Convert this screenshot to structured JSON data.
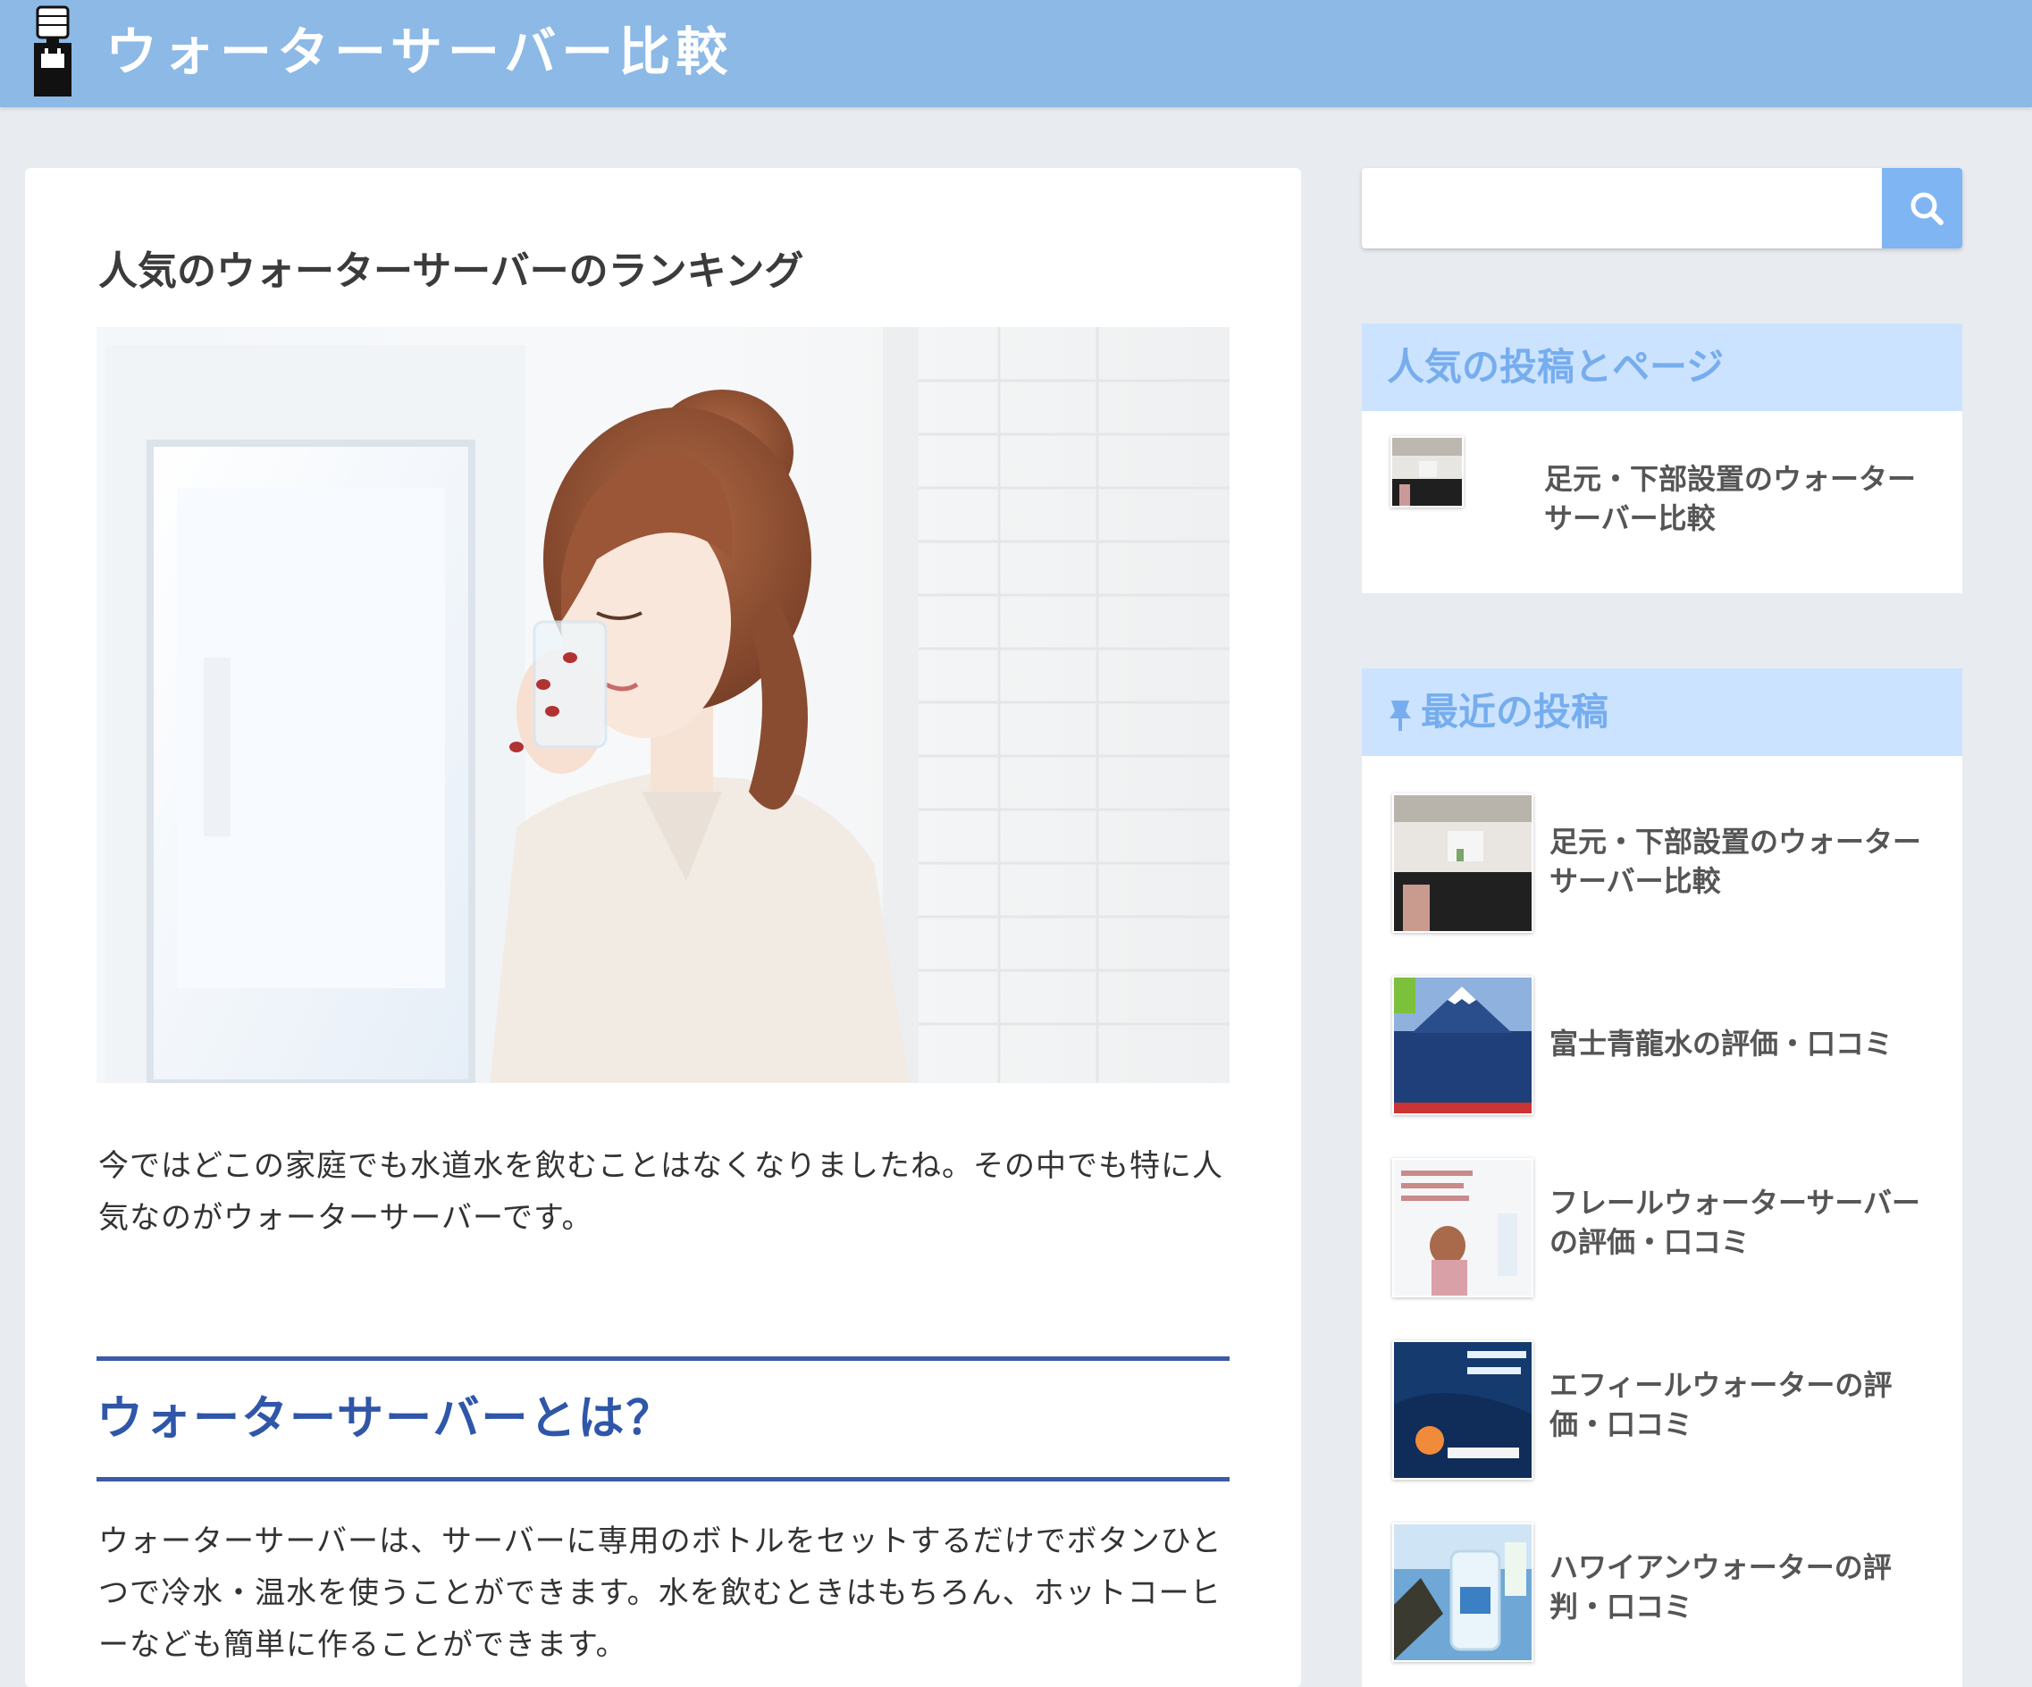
{
  "header": {
    "site_title": "ウォーターサーバー比較"
  },
  "article": {
    "title": "人気のウォーターサーバーのランキング",
    "intro": "今ではどこの家庭でも水道水を飲むことはなくなりましたね。その中でも特に人気なのがウォーターサーバーです。",
    "h2": "ウォーターサーバーとは？",
    "para2": "ウォーターサーバーは、サーバーに専用のボトルをセットするだけでボタンひとつで冷水・温水を使うことができます。水を飲むときはもちろん、ホットコーヒーなども簡単に作ることができます。"
  },
  "sidebar": {
    "search": {
      "placeholder": ""
    },
    "popular": {
      "title": "人気の投稿とページ",
      "items": [
        {
          "label": "足元・下部設置のウォーターサーバー比較"
        }
      ]
    },
    "recent": {
      "title": "最近の投稿",
      "items": [
        {
          "label": "足元・下部設置のウォーターサーバー比較"
        },
        {
          "label": "富士青龍水の評価・口コミ"
        },
        {
          "label": "フレールウォーターサーバーの評価・口コミ"
        },
        {
          "label": "エフィールウォーターの評価・口コミ"
        },
        {
          "label": "ハワイアンウォーターの評判・口コミ"
        }
      ]
    }
  },
  "colors": {
    "header_bg": "#8cb9e6",
    "widget_title_bg": "#cce3ff",
    "widget_title_text": "#76adee",
    "h2_color": "#2f56a8",
    "search_button": "#7fb5f2"
  },
  "icons": [
    "water-server-logo-icon",
    "search-icon",
    "pin-icon"
  ]
}
